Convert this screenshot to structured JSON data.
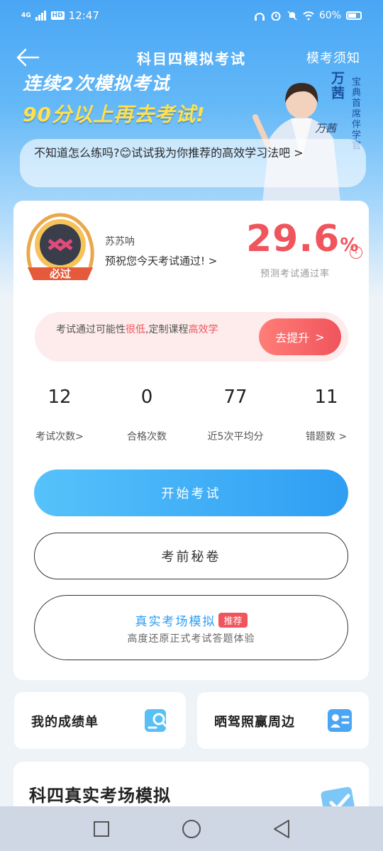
{
  "status": {
    "network": "4G",
    "hd": "HD",
    "time": "12:47",
    "battery": "60%"
  },
  "nav": {
    "title": "科目四模拟考试",
    "right_link": "模考须知"
  },
  "banner": {
    "line1": "连续2次模拟考试",
    "line2": "90分以上再去考试!",
    "person_name": "万茜",
    "person_tag": "宝典首席伴学官",
    "signature": "万茜"
  },
  "speech": {
    "text": "不知道怎么练吗?😊试试我为你推荐的高效学习法吧 >"
  },
  "profile": {
    "avatar_badge": "必过",
    "username": "苏苏呐",
    "wish": "预祝您今天考试通过! >",
    "pass_rate": "29.6",
    "pass_rate_unit": "%",
    "pass_rate_label": "预测考试通过率"
  },
  "advice": {
    "text_1": "考试通过可能性",
    "text_low": "很低",
    "text_2": ",定制课程",
    "text_efficient": "高效学",
    "button": "去提升",
    "button_arrow": ">"
  },
  "stats": [
    {
      "value": "12",
      "label": "考试次数>"
    },
    {
      "value": "0",
      "label": "合格次数"
    },
    {
      "value": "77",
      "label": "近5次平均分"
    },
    {
      "value": "11",
      "label": "错题数 >"
    }
  ],
  "actions": {
    "start": "开始考试",
    "secret": "考前秘卷",
    "real_title": "真实考场模拟",
    "real_badge": "推荐",
    "real_sub": "高度还原正式考试答题体验"
  },
  "mini_cards": [
    {
      "label": "我的成绩单",
      "icon": "report-search-icon"
    },
    {
      "label": "晒驾照赢周边",
      "icon": "id-card-icon"
    }
  ],
  "bottom": {
    "title": "科四真实考场模拟"
  },
  "colors": {
    "primary_blue": "#2f9ef3",
    "danger_red": "#f0545c",
    "banner_yellow": "#ffe14d"
  }
}
